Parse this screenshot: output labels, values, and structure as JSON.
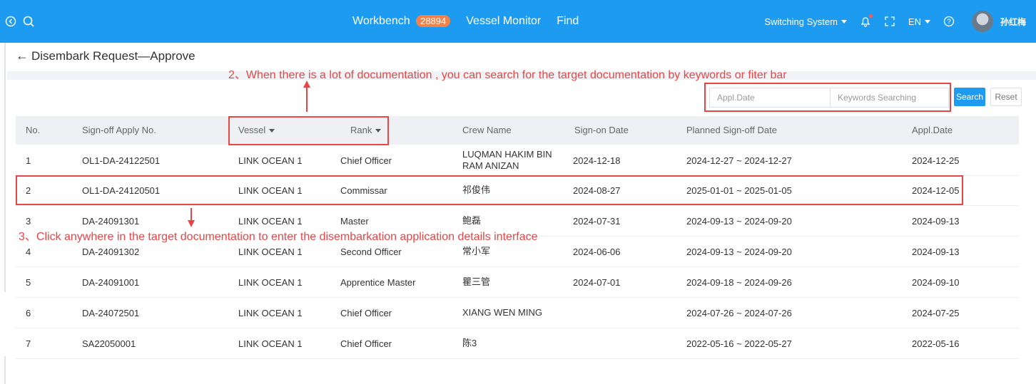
{
  "topbar": {
    "nav": {
      "workbench": "Workbench",
      "workbench_badge": "28894",
      "vessel_monitor": "Vessel Monitor",
      "find": "Find"
    },
    "switching_system": "Switching System",
    "language": "EN",
    "username": "孙红梅",
    "colors": {
      "bar": "#1d9bf0",
      "badge": "#f0834b"
    }
  },
  "page": {
    "title": "Disembark Request—Approve"
  },
  "annotations": {
    "note2": "2、When there is a lot of documentation , you can search for the target documentation by keywords or fiter bar",
    "note3": "3、Click anywhere in the target documentation to enter the disembarkation application details interface",
    "color": "#e64646"
  },
  "search": {
    "appl_date_placeholder": "Appl.Date",
    "keywords_placeholder": "Keywords Searching",
    "search_label": "Search",
    "reset_label": "Reset"
  },
  "table": {
    "headers": {
      "no": "No.",
      "apply_no": "Sign-off Apply No.",
      "vessel": "Vessel",
      "rank": "Rank",
      "crew_name": "Crew Name",
      "sign_on": "Sign-on Date",
      "planned": "Planned Sign-off Date",
      "appl_date": "Appl.Date"
    },
    "rows": [
      {
        "no": "1",
        "apply_no": "OL1-DA-24122501",
        "vessel": "LINK OCEAN 1",
        "rank": "Chief Officer",
        "crew": "LUQMAN HAKIM BIN RAM ANIZAN",
        "sign_on": "2024-12-18",
        "planned": "2024-12-27 ~ 2024-12-27",
        "appl_date": "2024-12-25"
      },
      {
        "no": "2",
        "apply_no": "OL1-DA-24120501",
        "vessel": "LINK OCEAN 1",
        "rank": "Commissar",
        "crew": "祁俊伟",
        "sign_on": "2024-08-27",
        "planned": "2025-01-01 ~ 2025-01-05",
        "appl_date": "2024-12-05"
      },
      {
        "no": "3",
        "apply_no": "DA-24091301",
        "vessel": "LINK OCEAN 1",
        "rank": "Master",
        "crew": "鲍磊",
        "sign_on": "2024-07-31",
        "planned": "2024-09-13 ~ 2024-09-20",
        "appl_date": "2024-09-13"
      },
      {
        "no": "4",
        "apply_no": "DA-24091302",
        "vessel": "LINK OCEAN 1",
        "rank": "Second Officer",
        "crew": "常小军",
        "sign_on": "2024-06-06",
        "planned": "2024-09-13 ~ 2024-09-20",
        "appl_date": "2024-09-13"
      },
      {
        "no": "5",
        "apply_no": "DA-24091001",
        "vessel": "LINK OCEAN 1",
        "rank": "Apprentice Master",
        "crew": "瞿三管",
        "sign_on": "2024-07-01",
        "planned": "2024-09-18 ~ 2024-09-26",
        "appl_date": "2024-09-10"
      },
      {
        "no": "6",
        "apply_no": "DA-24072501",
        "vessel": "LINK OCEAN 1",
        "rank": "Chief Officer",
        "crew": "XIANG WEN MING",
        "sign_on": "",
        "planned": "2024-07-26 ~ 2024-07-26",
        "appl_date": "2024-07-25"
      },
      {
        "no": "7",
        "apply_no": "SA22050001",
        "vessel": "LINK OCEAN 1",
        "rank": "Chief Officer",
        "crew": "陈3",
        "sign_on": "",
        "planned": "2022-05-16 ~ 2022-05-27",
        "appl_date": "2022-05-16"
      }
    ]
  }
}
